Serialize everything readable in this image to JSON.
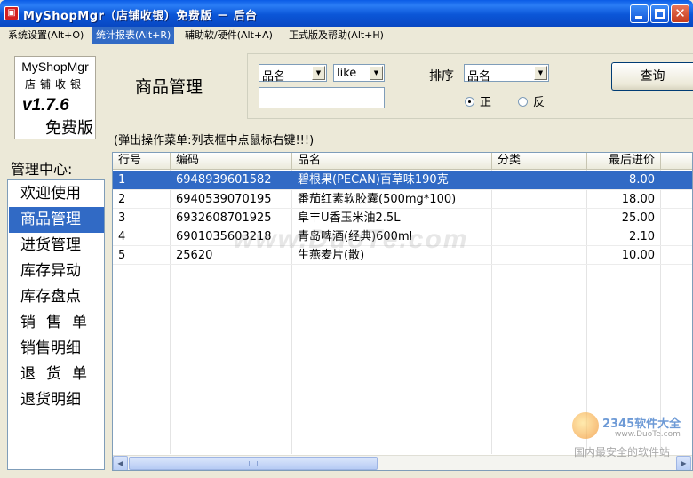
{
  "window": {
    "title": "MyShopMgr（店铺收银）免费版 － 后台",
    "icon_name": "app-red-square-icon"
  },
  "menu": [
    {
      "label": "系统设置(Alt+O)",
      "active": false
    },
    {
      "label": "统计报表(Alt+R)",
      "active": true
    },
    {
      "label": "辅助软/硬件(Alt+A)",
      "active": false
    },
    {
      "label": "正式版及帮助(Alt+H)",
      "active": false
    }
  ],
  "logo": {
    "line1": "MyShopMgr",
    "line2": "店铺收银",
    "version": "v1.7.6",
    "edition": "免费版"
  },
  "page_title": "商品管理",
  "query": {
    "field_select": "品名",
    "op_select": "like",
    "keyword_value": "",
    "sort_label": "排序",
    "sort_select": "品名",
    "sort_asc_label": "正",
    "sort_desc_label": "反",
    "sort_direction": "asc",
    "query_button": "查询"
  },
  "hint": "(弹出操作菜单:列表框中点鼠标右键!!!)",
  "sidebar": {
    "title": "管理中心:",
    "items": [
      "欢迎使用",
      "商品管理",
      "进货管理",
      "库存异动",
      "库存盘点",
      "销售单",
      "销售明细",
      "退货单",
      "退货明细"
    ],
    "active_index": 1
  },
  "table": {
    "columns": [
      "行号",
      "编码",
      "品名",
      "分类",
      "最后进价"
    ],
    "rows": [
      {
        "no": "1",
        "code": "6948939601582",
        "name": "碧根果(PECAN)百草味190克",
        "category": "",
        "price": "8.00"
      },
      {
        "no": "2",
        "code": "6940539070195",
        "name": "番茄红素软胶囊(500mg*100)",
        "category": "",
        "price": "18.00"
      },
      {
        "no": "3",
        "code": "6932608701925",
        "name": "阜丰U香玉米油2.5L",
        "category": "",
        "price": "25.00"
      },
      {
        "no": "4",
        "code": "6901035603218",
        "name": "青岛啤酒(经典)600ml",
        "category": "",
        "price": "2.10"
      },
      {
        "no": "5",
        "code": "25620",
        "name": "生燕麦片(散)",
        "category": "",
        "price": "10.00"
      }
    ],
    "selected_row": 0
  },
  "watermark": {
    "text": "www.DuoTe.com",
    "brand": "2345软件大全",
    "url": "www.DuoTe.com",
    "slogan": "国内最安全的软件站"
  },
  "colors": {
    "selection": "#316ac5",
    "titlebar": "#0b56d8"
  }
}
